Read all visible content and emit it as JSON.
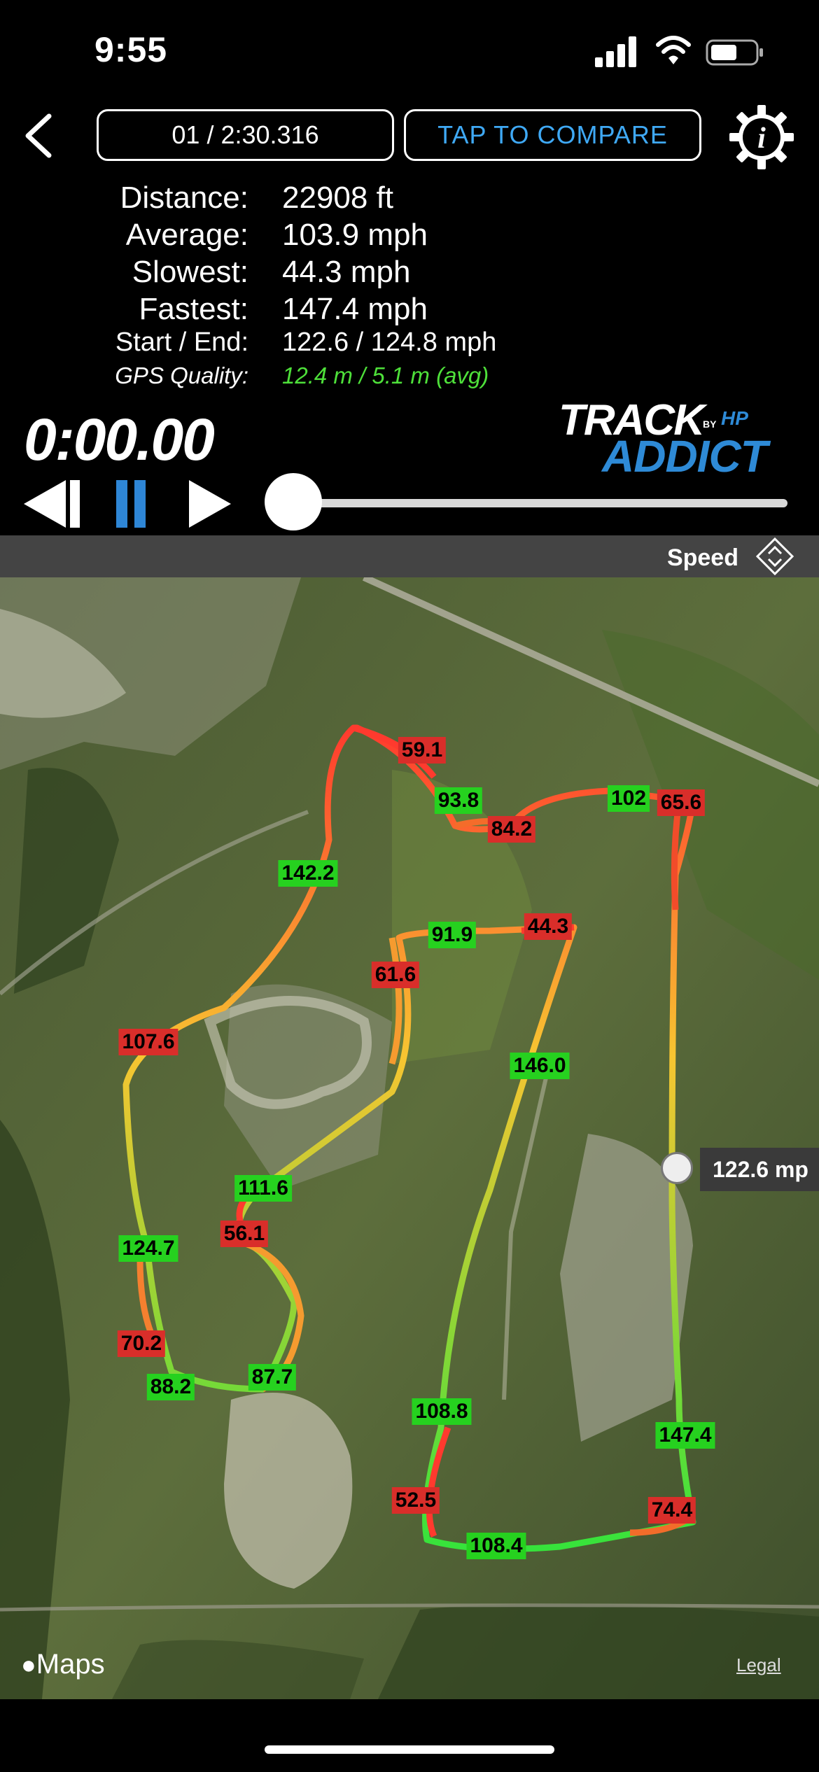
{
  "status": {
    "time": "9:55"
  },
  "header": {
    "lap_label": "01 / 2:30.316",
    "compare_label": "TAP TO COMPARE"
  },
  "stats": [
    {
      "label": "Distance:",
      "value": "22908 ft"
    },
    {
      "label": "Average:",
      "value": "103.9 mph"
    },
    {
      "label": "Slowest:",
      "value": "44.3 mph"
    },
    {
      "label": "Fastest:",
      "value": "147.4 mph"
    },
    {
      "label": "Start / End:",
      "value": "122.6 / 124.8 mph"
    },
    {
      "label": "GPS Quality:",
      "value": "12.4 m / 5.1 m (avg)"
    }
  ],
  "logo": {
    "line1": "TRACK",
    "line2": "ADDICT",
    "by": "BY",
    "brand": "HP"
  },
  "playback": {
    "timer": "0:00.00",
    "progress": 0
  },
  "speed_selector": {
    "label": "Speed"
  },
  "map": {
    "speed_labels": [
      {
        "value": "59.1",
        "color": "red"
      },
      {
        "value": "93.8",
        "color": "green"
      },
      {
        "value": "84.2",
        "color": "red"
      },
      {
        "value": "102",
        "color": "green"
      },
      {
        "value": "65.6",
        "color": "red"
      },
      {
        "value": "142.2",
        "color": "green"
      },
      {
        "value": "91.9",
        "color": "green"
      },
      {
        "value": "44.3",
        "color": "red"
      },
      {
        "value": "61.6",
        "color": "red"
      },
      {
        "value": "146.0",
        "color": "green"
      },
      {
        "value": "107.6",
        "color": "red"
      },
      {
        "value": "111.6",
        "color": "green"
      },
      {
        "value": "56.1",
        "color": "red"
      },
      {
        "value": "124.7",
        "color": "green"
      },
      {
        "value": "70.2",
        "color": "red"
      },
      {
        "value": "88.2",
        "color": "green"
      },
      {
        "value": "87.7",
        "color": "green"
      },
      {
        "value": "108.8",
        "color": "green"
      },
      {
        "value": "147.4",
        "color": "green"
      },
      {
        "value": "52.5",
        "color": "red"
      },
      {
        "value": "74.4",
        "color": "red"
      },
      {
        "value": "108.4",
        "color": "green"
      }
    ],
    "marker_callout": "122.6 mp",
    "attribution": "Maps",
    "legal": "Legal"
  },
  "colors": {
    "accent": "#3fa9f5",
    "gps_good": "#4ee03a",
    "fast": "#26d11f",
    "slow": "#d92e2a"
  }
}
